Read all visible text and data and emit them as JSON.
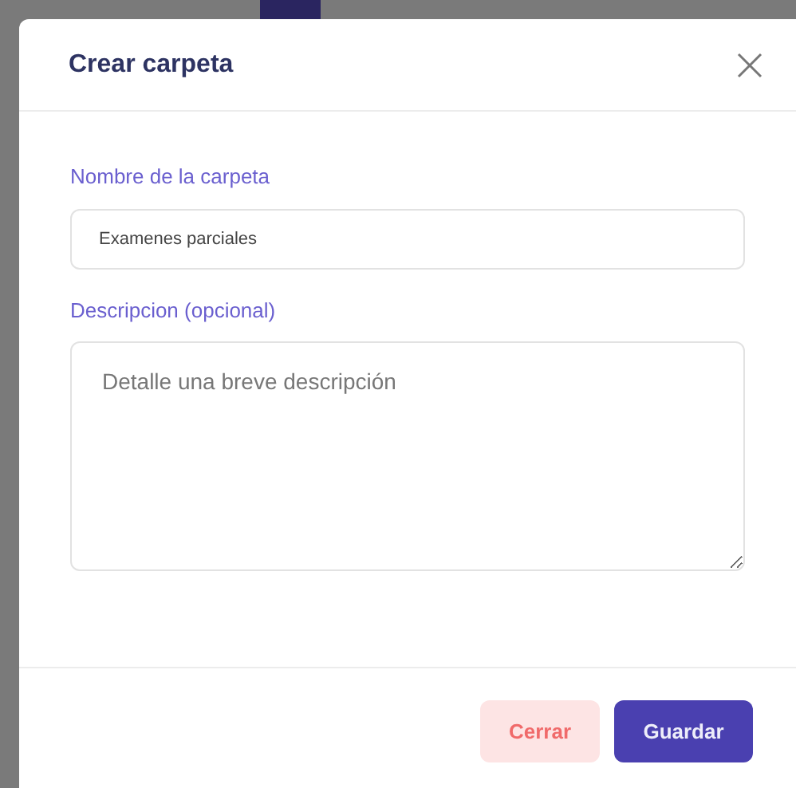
{
  "dialog": {
    "title": "Crear carpeta"
  },
  "fields": [
    {
      "kind": "input",
      "label": "Nombre de la carpeta",
      "value": "Examenes parciales"
    },
    {
      "kind": "textarea",
      "label": "Descripcion (opcional)",
      "placeholder": "Detalle una breve descripción"
    }
  ],
  "buttons": [
    {
      "kind": "secondary",
      "label": "Cerrar"
    },
    {
      "kind": "primary",
      "label": "Guardar"
    }
  ]
}
